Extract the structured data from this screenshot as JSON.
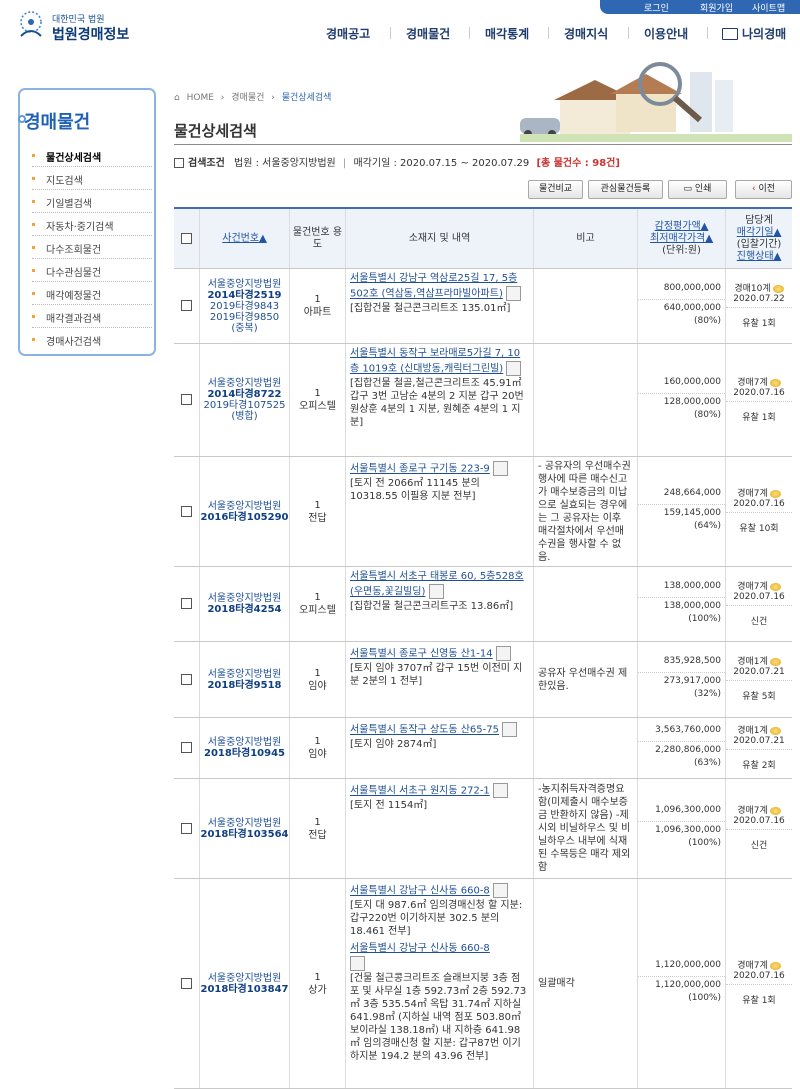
{
  "site": {
    "emblem_text": "대한민국 법원",
    "name": "법원경매정보"
  },
  "util": [
    "로그인",
    "회원가입",
    "사이트맵"
  ],
  "nav": [
    "경매공고",
    "경매물건",
    "매각통계",
    "경매지식",
    "이용안내",
    "나의경매"
  ],
  "sidebar": {
    "title": "경매물건",
    "items": [
      {
        "label": "물건상세검색"
      },
      {
        "label": "지도검색"
      },
      {
        "label": "기일별검색"
      },
      {
        "label": "자동차·중기검색"
      },
      {
        "label": "다수조회물건"
      },
      {
        "label": "다수관심물건"
      },
      {
        "label": "매각예정물건"
      },
      {
        "label": "매각결과검색"
      },
      {
        "label": "경매사건검색"
      }
    ]
  },
  "breadcrumb": [
    "HOME",
    "경매물건",
    "물건상세검색"
  ],
  "page_title": "물건상세검색",
  "search": {
    "label": "검색조건",
    "court": "법원 : 서울중앙지방법원",
    "period": "매각기일 : 2020.07.15 ~ 2020.07.29",
    "total": "[총 물건수 : 98건]"
  },
  "buttons": {
    "compare": "물건비교",
    "interest": "관심물건등록",
    "print": "인쇄",
    "prev": "이전"
  },
  "table": {
    "headers": {
      "case": "사건번호▲",
      "usage": "물건번호 용도",
      "addr": "소재지 및 내역",
      "note": "비고",
      "price_a": "감정평가액▲",
      "price_b": "최저매각가격▲",
      "price_c": "(단위:원)",
      "stat_a": "담당계",
      "stat_b": "매각기일▲",
      "stat_c": "(입찰기간)",
      "stat_d": "진행상태▲"
    },
    "rows": [
      {
        "court": "서울중앙지방법원",
        "case": "2014타경2519",
        "sub1": "2019타경9843",
        "sub2": "2019타경9850",
        "sub3": "(중복)",
        "no": "1",
        "usage": "아파트",
        "addr": "서울특별시 강남구 역삼로25길 17, 5층 502호 (역삼동,역삼프라마빌아파트)",
        "desc": "[집합건물 철근콘크리트조 135.01㎡]",
        "addr2": "",
        "desc2": "",
        "note": "",
        "appraisal": "800,000,000",
        "minimum": "640,000,000",
        "ratio": "(80%)",
        "dept": "경매10계",
        "date": "2020.07.22",
        "status": "유찰 1회"
      },
      {
        "court": "서울중앙지방법원",
        "case": "2014타경8722",
        "sub1": "2019타경107525",
        "sub2": "(병합)",
        "sub3": "",
        "no": "1",
        "usage": "오피스텔",
        "addr": "서울특별시 동작구 보라매로5가길 7, 10층 1019호 (신대방동,캐릭터그린빌)",
        "desc": "[집합건물 철골,철근콘크리트조 45.91㎡ 갑구 3번 고남순 4분의 2 지분 갑구 20번 원상훈 4분의 1 지분, 원혜준 4분의 1 지분]",
        "addr2": "",
        "desc2": "",
        "note": "",
        "appraisal": "160,000,000",
        "minimum": "128,000,000",
        "ratio": "(80%)",
        "dept": "경매7계",
        "date": "2020.07.16",
        "status": "유찰 1회"
      },
      {
        "court": "서울중앙지방법원",
        "case": "2016타경105290",
        "sub1": "",
        "sub2": "",
        "sub3": "",
        "no": "1",
        "usage": "전답",
        "addr": "서울특별시 종로구 구기동 223-9",
        "desc": "[토지 전 2066㎡ 11145 분의 10318.55 이필용 지분 전부]",
        "addr2": "",
        "desc2": "",
        "note": "- 공유자의 우선매수권 행사에 따른 매수신고가 매수보증금의 미납으로 실효되는 경우에는 그 공유자는 이후 매각절차에서 우선매수권을 행사할 수 없음.",
        "appraisal": "248,664,000",
        "minimum": "159,145,000",
        "ratio": "(64%)",
        "dept": "경매7계",
        "date": "2020.07.16",
        "status": "유찰 10회"
      },
      {
        "court": "서울중앙지방법원",
        "case": "2018타경4254",
        "sub1": "",
        "sub2": "",
        "sub3": "",
        "no": "1",
        "usage": "오피스텔",
        "addr": "서울특별시 서초구 태봉로 60, 5층528호 (우면동,꽃길빌딩)",
        "desc": "[집합건물 철근콘크리트구조 13.86㎡]",
        "addr2": "",
        "desc2": "",
        "note": "",
        "appraisal": "138,000,000",
        "minimum": "138,000,000",
        "ratio": "(100%)",
        "dept": "경매7계",
        "date": "2020.07.16",
        "status": "신건"
      },
      {
        "court": "서울중앙지방법원",
        "case": "2018타경9518",
        "sub1": "",
        "sub2": "",
        "sub3": "",
        "no": "1",
        "usage": "임야",
        "addr": "서울특별시 종로구 신영동 산1-14",
        "desc": "[토지 임야 3707㎡ 갑구 15번 이전미 지분 2분의 1 전부]",
        "addr2": "",
        "desc2": "",
        "note": "공유자 우선매수권 제한있음.",
        "appraisal": "835,928,500",
        "minimum": "273,917,000",
        "ratio": "(32%)",
        "dept": "경매1계",
        "date": "2020.07.21",
        "status": "유찰 5회"
      },
      {
        "court": "서울중앙지방법원",
        "case": "2018타경10945",
        "sub1": "",
        "sub2": "",
        "sub3": "",
        "no": "1",
        "usage": "임야",
        "addr": "서울특별시 동작구 상도동 산65-75",
        "desc": "[토지 임야 2874㎡]",
        "addr2": "",
        "desc2": "",
        "note": "",
        "appraisal": "3,563,760,000",
        "minimum": "2,280,806,000",
        "ratio": "(63%)",
        "dept": "경매1계",
        "date": "2020.07.21",
        "status": "유찰 2회"
      },
      {
        "court": "서울중앙지방법원",
        "case": "2018타경103564",
        "sub1": "",
        "sub2": "",
        "sub3": "",
        "no": "1",
        "usage": "전답",
        "addr": "서울특별시 서초구 원지동 272-1",
        "desc": "[토지 전 1154㎡]",
        "addr2": "",
        "desc2": "",
        "note": "-농지취득자격증명요함(미제출시 매수보증금 반환하지 않음) -제시외 비닐하우스 및 비닐하우스 내부에 식재된 수목등은 매각 제외함",
        "appraisal": "1,096,300,000",
        "minimum": "1,096,300,000",
        "ratio": "(100%)",
        "dept": "경매7계",
        "date": "2020.07.16",
        "status": "신건"
      },
      {
        "court": "서울중앙지방법원",
        "case": "2018타경103847",
        "sub1": "",
        "sub2": "",
        "sub3": "",
        "no": "1",
        "usage": "상가",
        "addr": "서울특별시 강남구 신사동 660-8",
        "desc": "[토지 대 987.6㎡ 임의경매신청 할 지분: 갑구220번 이기하지분 302.5 분의 18.461 전부]",
        "addr2": "서울특별시 강남구 신사동 660-8",
        "desc2": "[건물 철근콩크리트조 슬래브지붕 3층 점포 및 사무실 1층 592.73㎡ 2층 592.73㎡ 3층 535.54㎡ 옥탑 31.74㎡ 지하실 641.98㎡ (지하실 내역 점포 503.80㎡ 보이라실 138.18㎡) 내 지하층 641.98㎡ 임의경매신청 할 지분: 갑구87번 이기하지분 194.2 분의 43.96 전부]",
        "note": "일괄매각",
        "appraisal": "1,120,000,000",
        "minimum": "1,120,000,000",
        "ratio": "(100%)",
        "dept": "경매7계",
        "date": "2020.07.16",
        "status": "유찰 1회"
      }
    ]
  }
}
